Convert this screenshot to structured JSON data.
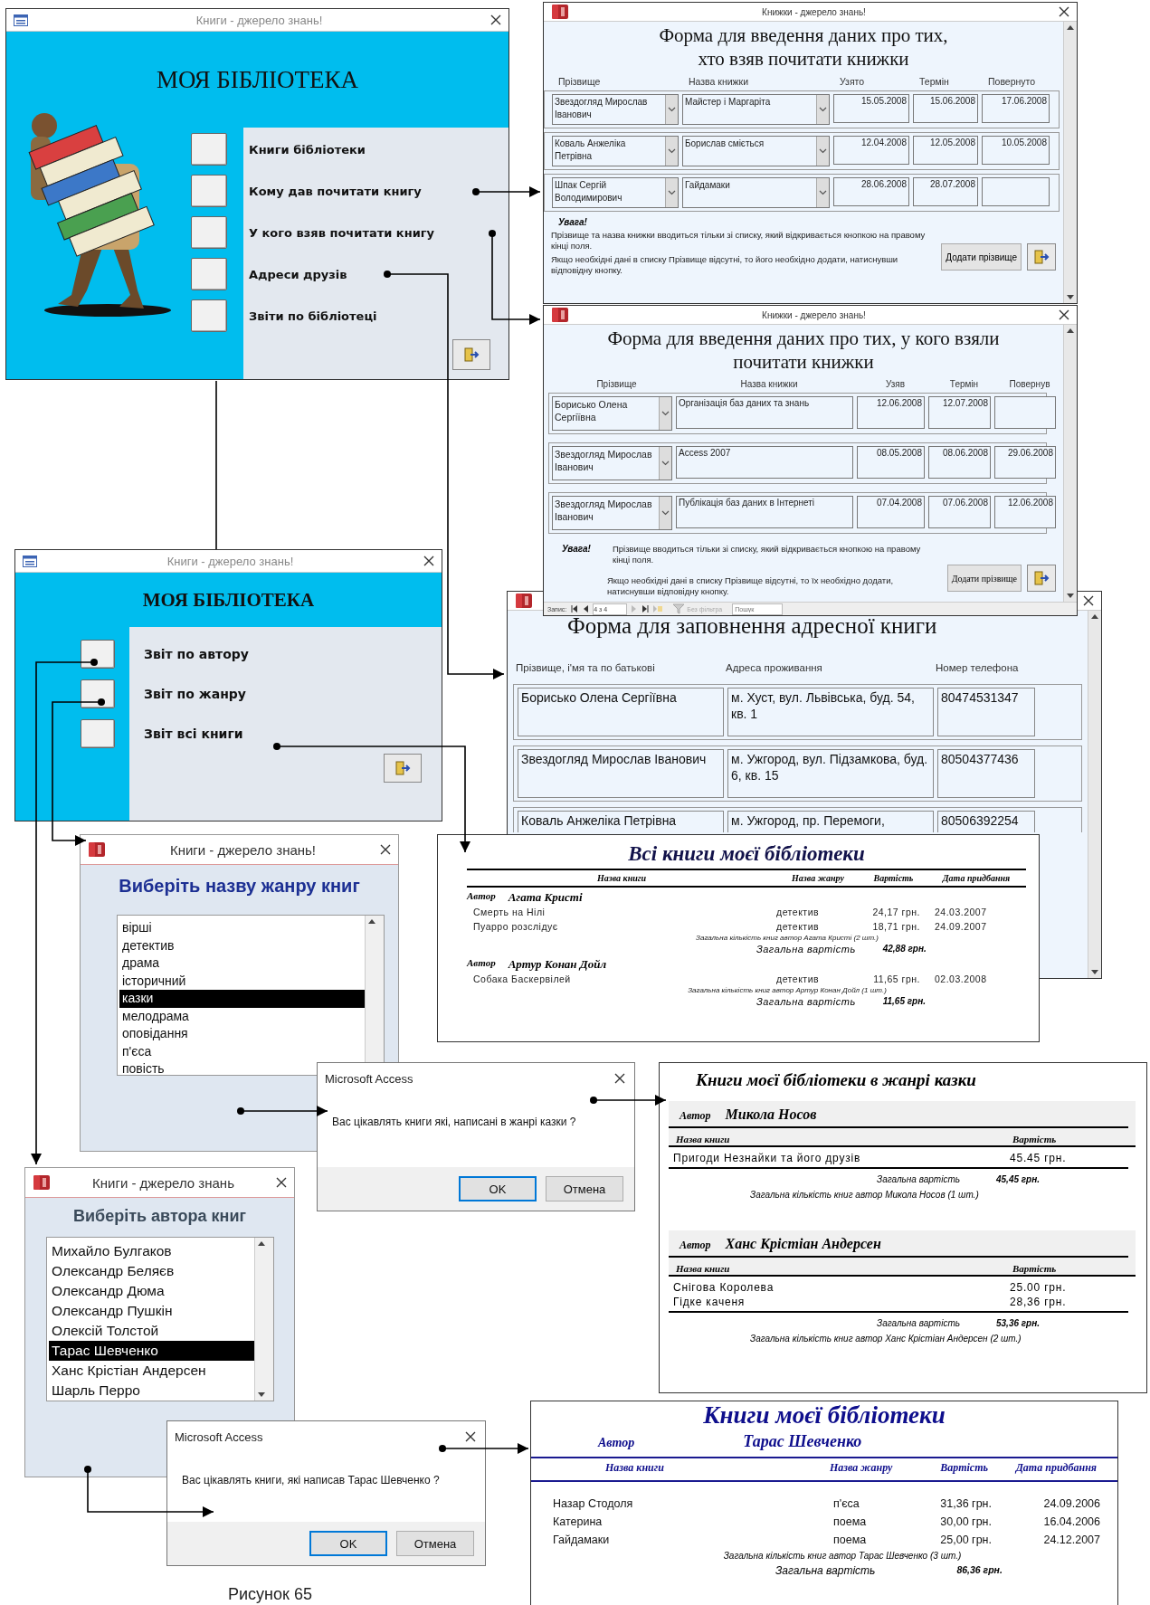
{
  "main_menu": {
    "title": "Книги - джерело знань!",
    "heading": "МОЯ БІБЛІОТЕКА",
    "items": [
      {
        "label": "Книги бібліотеки"
      },
      {
        "label": "Кому дав почитати книгу"
      },
      {
        "label": "У кого взяв почитати книгу"
      },
      {
        "label": "Адреси друзів"
      },
      {
        "label": "Звіти по бібліотеці"
      }
    ]
  },
  "borrowed_form": {
    "title": "Книжки - джерело знань!",
    "heading": "Форма для введення даних про тих,\nхто взяв почитати книжки",
    "columns": [
      "Прізвище",
      "Назва книжки",
      "Узято",
      "Термін",
      "Повернуто"
    ],
    "rows": [
      {
        "name": "Звездогляд Мирослав Іванович",
        "book": "Майстер і Маргаріта",
        "taken": "15.05.2008",
        "due": "15.06.2008",
        "returned": "17.06.2008"
      },
      {
        "name": "Коваль Анжеліка Петрівна",
        "book": "Борислав сміється",
        "taken": "12.04.2008",
        "due": "12.05.2008",
        "returned": "10.05.2008"
      },
      {
        "name": "Шпак Сергій Володимирович",
        "book": "Гайдамаки",
        "taken": "28.06.2008",
        "due": "28.07.2008"
      }
    ],
    "note_title": "Увага!",
    "notes": [
      "Прізвище та назва книжки вводиться тільки зі списку, який відкривається кнопкою на правому кінці поля.",
      "Якщо необхідні дані в списку Прізвище відсутні, то його необхідно додати, натиснувши відповідну кнопку."
    ],
    "add_button": "Додати прізвище"
  },
  "lent_form": {
    "title": "Книжки - джерело знань!",
    "heading": "Форма для введення даних про тих, у кого взяли\nпочитати книжки",
    "columns": [
      "Прізвище",
      "Назва книжки",
      "Узяв",
      "Термін",
      "Повернув"
    ],
    "rows": [
      {
        "name": "Борисько Олена Сергіївна",
        "book": "Організація баз даних та знань",
        "taken": "12.06.2008",
        "due": "12.07.2008"
      },
      {
        "name": "Звездогляд Мирослав Іванович",
        "book": "Access 2007",
        "taken": "08.05.2008",
        "due": "08.06.2008",
        "returned": "29.06.2008"
      },
      {
        "name": "Звездогляд Мирослав Іванович",
        "book": "Публікація баз даних в Інтернеті",
        "taken": "07.04.2008",
        "due": "07.06.2008",
        "returned": "12.06.2008"
      }
    ],
    "note_title": "Увага!",
    "notes": [
      "Прізвище вводиться тільки зі списку, який відкривається кнопкою на правому кінці поля.",
      "Якщо необхідні дані в списку Прізвище відсутні, то їх необхідно додати, натиснувши відповідну кнопку."
    ],
    "add_button": "Додати прізвище",
    "nav": {
      "label": "Запис:",
      "position": "4 з 4",
      "filter": "Без фільтра",
      "search_placeholder": "Пошук"
    }
  },
  "address_form": {
    "heading": "Форма для заповнення адресної книги",
    "columns": [
      "Прізвище, і'мя та по батькові",
      "Адреса проживання",
      "Номер телефона"
    ],
    "rows": [
      {
        "name": "Борисько Олена Сергіївна",
        "address": "м. Хуст, вул. Львівська, буд. 54, кв. 1",
        "phone": "80474531347"
      },
      {
        "name": "Звездогляд Мирослав Іванович",
        "address": "м. Ужгород, вул. Підзамкова, буд. 6, кв. 15",
        "phone": "80504377436"
      },
      {
        "name": "Коваль Анжеліка Петрівна",
        "address": "м. Ужгород, пр. Перемоги,",
        "phone": "80506392254"
      }
    ]
  },
  "reports_menu": {
    "title": "Книги - джерело знань!",
    "heading": "МОЯ БІБЛІОТЕКА",
    "items": [
      {
        "label": "Звіт по автору"
      },
      {
        "label": "Звіт по жанру"
      },
      {
        "label": "Звіт всі книги"
      }
    ]
  },
  "all_books_report": {
    "title": "Всі книги моєї бібліотеки",
    "columns": [
      "Назва книги",
      "Назва жанру",
      "Вартість",
      "Дата придбання"
    ],
    "groups": [
      {
        "author_label": "Автор",
        "author": "Агата Кристі",
        "rows": [
          [
            "Смерть на Нілі",
            "детектив",
            "24,17 грн.",
            "24.03.2007"
          ],
          [
            "Пуарро розслідує",
            "детектив",
            "18,71 грн.",
            "24.09.2007"
          ]
        ],
        "count_line": "Загальна кількість книг автор  Агата Кристі (2 шт.)",
        "total_label": "Загальна вартість",
        "total": "42,88 грн."
      },
      {
        "author_label": "Автор",
        "author": "Артур Конан Дойл",
        "rows": [
          [
            "Собака Баскервілей",
            "детектив",
            "11,65 грн.",
            "02.03.2008"
          ]
        ],
        "count_line": "Загальна кількість книг автор  Артур Конан Дойл (1 шт.)",
        "total_label": "Загальна вартість",
        "total": "11,65 грн."
      }
    ]
  },
  "genre_picker": {
    "title": "Книги - джерело знань!",
    "heading": "Виберіть назву жанру книг",
    "items": [
      {
        "label": "вірші",
        "selected": false
      },
      {
        "label": "детектив",
        "selected": false
      },
      {
        "label": "драма",
        "selected": false
      },
      {
        "label": "історичний",
        "selected": false
      },
      {
        "label": "казки",
        "selected": true
      },
      {
        "label": "мелодрама",
        "selected": false
      },
      {
        "label": "оповідання",
        "selected": false
      },
      {
        "label": "п'єса",
        "selected": false
      },
      {
        "label": "повість",
        "selected": false
      }
    ]
  },
  "genre_dialog": {
    "title": "Microsoft Access",
    "message": "Вас цікавлять книги які, написані в жанрі казки ?",
    "buttons": [
      {
        "label": "OK",
        "default": true
      },
      {
        "label": "Отмена",
        "default": false
      }
    ]
  },
  "genre_report": {
    "title": "Книги моєї бібліотеки в жанрі  казки",
    "groups": [
      {
        "author_label": "Автор",
        "author": "Микола Носов",
        "columns": [
          "Назва книги",
          "Вартість"
        ],
        "rows": [
          [
            "Пригоди Незнайки та його друзів",
            "45.45 грн."
          ]
        ],
        "total_label": "Загальна вартість",
        "total": "45,45 грн.",
        "count_line": "Загальна кількість книг автор  Микола Носов (1 шт.)"
      },
      {
        "author_label": "Автор",
        "author": "Ханс Крістіан Андерсен",
        "columns": [
          "Назва книги",
          "Вартість"
        ],
        "rows": [
          [
            "Снігова Королева",
            "25.00 грн."
          ],
          [
            "Гідке каченя",
            "28,36 грн."
          ]
        ],
        "total_label": "Загальна вартість",
        "total": "53,36 грн.",
        "count_line": "Загальна кількість книг автор  Ханс Крістіан Андерсен (2 шт.)"
      }
    ]
  },
  "author_picker": {
    "title": "Книги - джерело знань",
    "heading": "Виберіть автора книг",
    "items": [
      {
        "label": "Михайло Булгаков",
        "selected": false
      },
      {
        "label": "Олександр Беляєв",
        "selected": false
      },
      {
        "label": "Олександр Дюма",
        "selected": false
      },
      {
        "label": "Олександр Пушкін",
        "selected": false
      },
      {
        "label": "Олексій Толстой",
        "selected": false
      },
      {
        "label": "Тарас Шевченко",
        "selected": true
      },
      {
        "label": "Ханс Крістіан Андерсен",
        "selected": false
      },
      {
        "label": "Шарль Перро",
        "selected": false
      }
    ]
  },
  "author_dialog": {
    "title": "Microsoft Access",
    "message": "Вас цікавлять книги, які написав Тарас Шевченко ?",
    "buttons": [
      {
        "label": "OK",
        "default": true
      },
      {
        "label": "Отмена",
        "default": false
      }
    ]
  },
  "author_report": {
    "title": "Книги моєї бібліотеки",
    "author_label": "Автор",
    "author": "Тарас Шевченко",
    "columns": [
      "Назва книги",
      "Назва жанру",
      "Вартість",
      "Дата придбання"
    ],
    "rows": [
      [
        "Назар Стодоля",
        "п'єса",
        "31,36 грн.",
        "24.09.2006"
      ],
      [
        "Катерина",
        "поема",
        "30,00 грн.",
        "16.04.2006"
      ],
      [
        "Гайдамаки",
        "поема",
        "25,00 грн.",
        "24.12.2007"
      ]
    ],
    "count_line": "Загальна кількість книг автор  Тарас Шевченко (3 шт.)",
    "total_label": "Загальна вартість",
    "total": "86,36 грн."
  },
  "caption": "Рисунок 65"
}
